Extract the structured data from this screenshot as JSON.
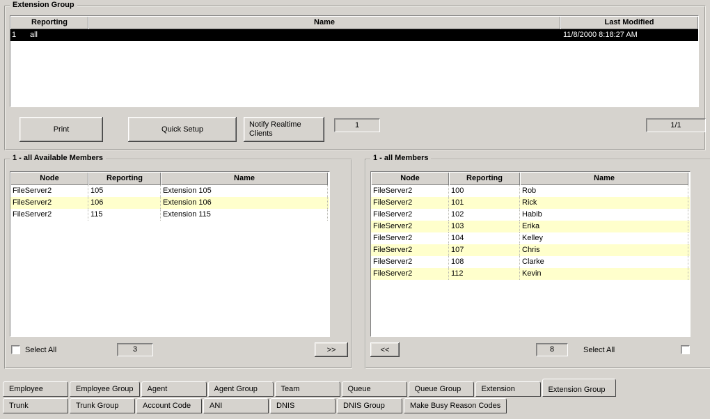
{
  "colors": {
    "background": "#d6d3ce",
    "row_highlight": "#ffffcc",
    "selected_row_bg": "#000000",
    "selected_row_fg": "#ffffff"
  },
  "extension_group": {
    "title": "Extension Group",
    "columns": [
      "Reporting",
      "Name",
      "Last Modified"
    ],
    "selected_row": {
      "reporting": "1",
      "name": "all",
      "last_modified": "11/8/2000 8:18:27 AM"
    }
  },
  "toolbar": {
    "print_label": "Print",
    "quick_setup_label": "Quick Setup",
    "notify_label": "Notify Realtime Clients",
    "count_value": "1",
    "page_value": "1/1"
  },
  "available_members": {
    "title": "1 - all Available Members",
    "columns": [
      "Node",
      "Reporting",
      "Name"
    ],
    "rows": [
      [
        "FileServer2",
        "105",
        "Extension 105"
      ],
      [
        "FileServer2",
        "106",
        "Extension 106"
      ],
      [
        "FileServer2",
        "115",
        "Extension 115"
      ]
    ],
    "select_all_label": "Select All",
    "count_value": "3",
    "add_button_label": ">>"
  },
  "members": {
    "title": "1 - all Members",
    "columns": [
      "Node",
      "Reporting",
      "Name"
    ],
    "rows": [
      [
        "FileServer2",
        "100",
        "Rob"
      ],
      [
        "FileServer2",
        "101",
        "Rick"
      ],
      [
        "FileServer2",
        "102",
        "Habib"
      ],
      [
        "FileServer2",
        "103",
        "Erika"
      ],
      [
        "FileServer2",
        "104",
        "Kelley"
      ],
      [
        "FileServer2",
        "107",
        "Chris"
      ],
      [
        "FileServer2",
        "108",
        "Clarke"
      ],
      [
        "FileServer2",
        "112",
        "Kevin"
      ]
    ],
    "remove_button_label": "<<",
    "count_value": "8",
    "select_all_label": "Select All"
  },
  "tabs": {
    "active": "Extension Group",
    "row1": [
      "Employee",
      "Employee Group",
      "Agent",
      "Agent Group",
      "Team",
      "Queue",
      "Queue Group",
      "Extension",
      "Extension Group"
    ],
    "row2": [
      "Trunk",
      "Trunk Group",
      "Account Code",
      "ANI",
      "DNIS",
      "DNIS Group",
      "Make Busy Reason Codes"
    ]
  }
}
